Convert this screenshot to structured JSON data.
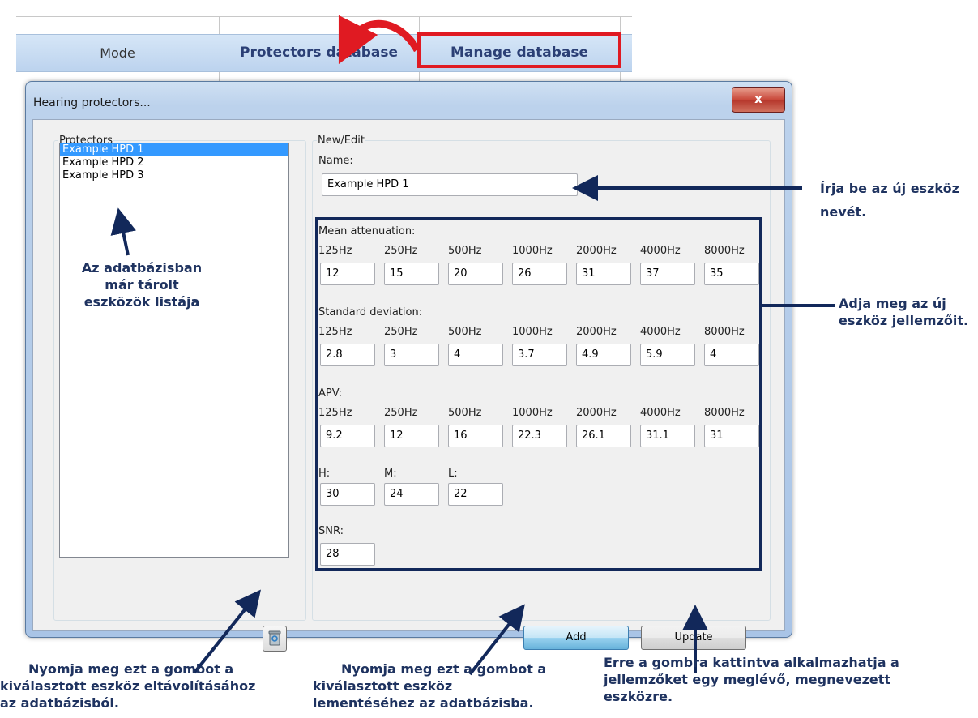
{
  "sheet": {
    "mode_label": "Mode",
    "tab_protectors": "Protectors database",
    "tab_manage": "Manage database"
  },
  "window": {
    "title": "Hearing protectors...",
    "close_glyph": "x"
  },
  "protectors": {
    "legend": "Protectors",
    "items": [
      "Example HPD 1",
      "Example HPD 2",
      "Example HPD 3"
    ],
    "selected_index": 0
  },
  "edit": {
    "legend": "New/Edit",
    "name_label": "Name:",
    "name_value": "Example HPD 1",
    "freqs": [
      "125Hz",
      "250Hz",
      "500Hz",
      "1000Hz",
      "2000Hz",
      "4000Hz",
      "8000Hz"
    ],
    "mean_label": "Mean attenuation:",
    "mean_values": [
      "12",
      "15",
      "20",
      "26",
      "31",
      "37",
      "35"
    ],
    "sd_label": "Standard deviation:",
    "sd_values": [
      "2.8",
      "3",
      "4",
      "3.7",
      "4.9",
      "5.9",
      "4"
    ],
    "apv_label": "APV:",
    "apv_values": [
      "9.2",
      "12",
      "16",
      "22.3",
      "26.1",
      "31.1",
      "31"
    ],
    "h_label": "H:",
    "m_label": "M:",
    "l_label": "L:",
    "h_value": "30",
    "m_value": "24",
    "l_value": "22",
    "snr_label": "SNR:",
    "snr_value": "28",
    "add_label": "Add",
    "update_label": "Update"
  },
  "annotations": {
    "name_hint_1": "Írja be az új eszköz",
    "name_hint_2": "nevét.",
    "props_hint_1": "Adja meg az új",
    "props_hint_2": "eszköz jellemzőit.",
    "list_hint_1": "Az adatbázisban",
    "list_hint_2": "már tárolt",
    "list_hint_3": "eszközök listája",
    "delete_hint_1": "Nyomja meg ezt a gombot a",
    "delete_hint_2": "kiválasztott eszköz eltávolításához",
    "delete_hint_3": "az adatbázisból.",
    "add_hint_1": "Nyomja meg ezt a gombot a",
    "add_hint_2": "kiválasztott eszköz",
    "add_hint_3": "lementéséhez az adatbázisba.",
    "update_hint_1": "Erre a gombra kattintva alkalmazhatja a",
    "update_hint_2": "jellemzőket egy meglévő, megnevezett",
    "update_hint_3": "eszközre."
  },
  "colors": {
    "highlight_red": "#e01a22",
    "annotation_navy": "#1f3360",
    "selection_blue": "#3399ff"
  }
}
